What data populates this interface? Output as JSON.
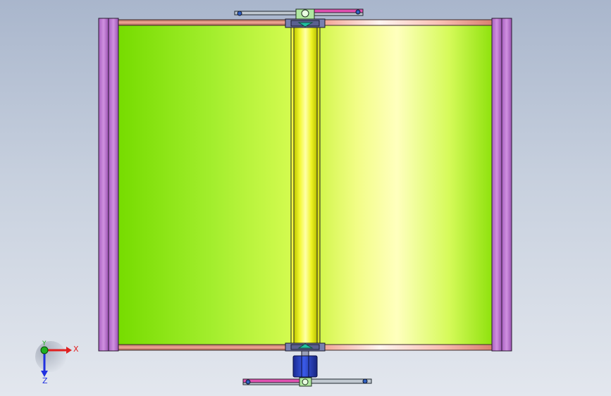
{
  "viewport": {
    "background_top": "#a9b6cc",
    "background_bottom": "#e3e7ee"
  },
  "model": {
    "panel_left_color": "#7be000",
    "panel_right_color": "#ffffb0",
    "end_plate_color": "#c47fd6",
    "rail_color": "#d98a78",
    "shaft_color": "#e8f000",
    "motor_color": "#2540c8"
  },
  "triad": {
    "x_label": "X",
    "y_label": "Y",
    "z_label": "Z",
    "x_color": "#e02020",
    "y_color": "#20b020",
    "z_color": "#2030e0"
  }
}
